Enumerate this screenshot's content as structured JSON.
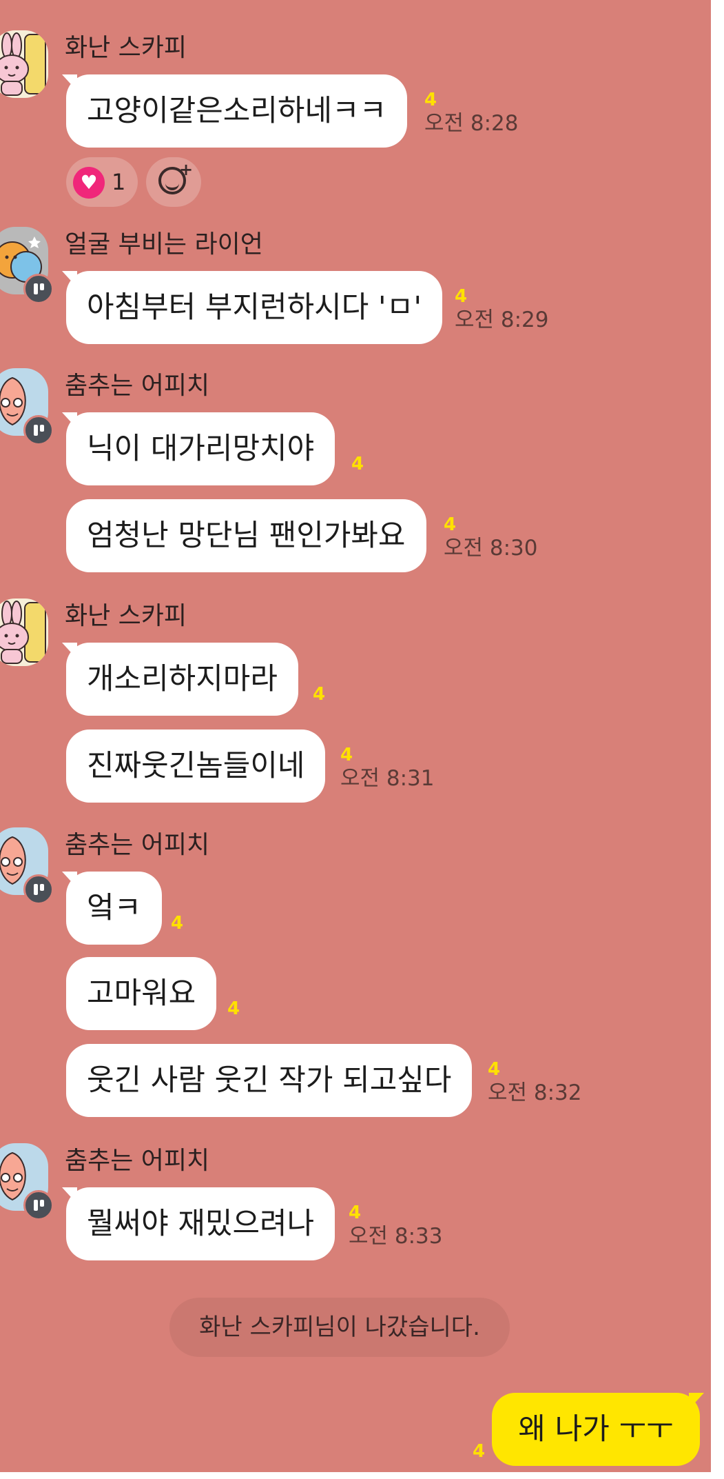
{
  "colors": {
    "chat_background": "#d88078",
    "bubble_other": "#ffffff",
    "bubble_mine": "#ffe600",
    "unread_count": "#ffe100",
    "reaction_heart": "#f0277a"
  },
  "groups": [
    {
      "sender": "화난 스카피",
      "avatar": "scappy-avatar",
      "messages": [
        {
          "text": "고양이같은소리하네ㅋㅋ",
          "unread": "4",
          "time": "오전 8:28"
        }
      ],
      "reaction": {
        "icon": "heart-icon",
        "count": "1"
      }
    },
    {
      "sender": "얼굴 부비는 라이언",
      "avatar": "lion-avatar",
      "messages": [
        {
          "text": "아침부터 부지런하시다 'ㅁ'",
          "unread": "4",
          "time": "오전 8:29"
        }
      ]
    },
    {
      "sender": "춤추는 어피치",
      "avatar": "apeach-avatar",
      "messages": [
        {
          "text": "닉이 대가리망치야",
          "unread": "4"
        },
        {
          "text": "엄청난 망단님 팬인가봐요",
          "unread": "4",
          "time": "오전 8:30"
        }
      ]
    },
    {
      "sender": "화난 스카피",
      "avatar": "scappy-avatar",
      "messages": [
        {
          "text": "개소리하지마라",
          "unread": "4"
        },
        {
          "text": "진짜웃긴놈들이네",
          "unread": "4",
          "time": "오전 8:31"
        }
      ]
    },
    {
      "sender": "춤추는 어피치",
      "avatar": "apeach-avatar",
      "messages": [
        {
          "text": "엌ㅋ",
          "unread": "4"
        },
        {
          "text": "고마워요",
          "unread": "4"
        },
        {
          "text": "웃긴 사람 웃긴 작가 되고싶다",
          "unread": "4",
          "time": "오전 8:32"
        }
      ]
    },
    {
      "sender": "춤추는 어피치",
      "avatar": "apeach-avatar",
      "messages": [
        {
          "text": "뭘써야 재밌으려나",
          "unread": "4",
          "time": "오전 8:33"
        }
      ]
    }
  ],
  "system_notice": "화난 스카피님이 나갔습니다.",
  "my_message": {
    "text": "왜 나가 ㅜㅜ",
    "unread": "4"
  }
}
